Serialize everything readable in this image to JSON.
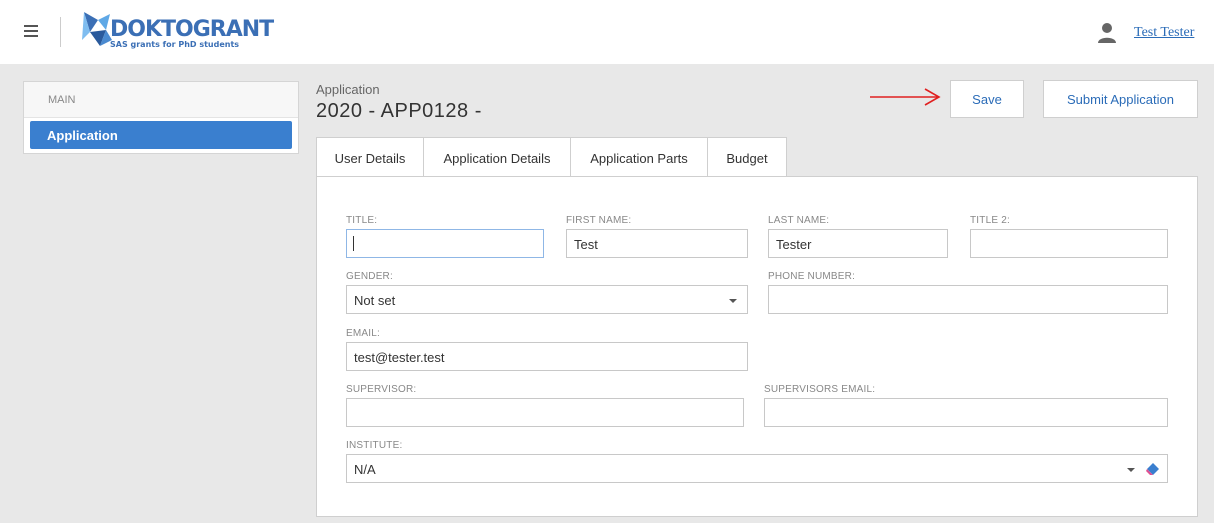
{
  "header": {
    "logo_text_main": "DOKTO",
    "logo_text_accent": "GRANT",
    "logo_subtitle": "SAS grants for PhD students",
    "user_name": "Test Tester",
    "menu_icon": "hamburger-icon",
    "user_icon": "user-icon"
  },
  "sidebar": {
    "section": "MAIN",
    "items": [
      {
        "label": "Application",
        "active": true
      }
    ]
  },
  "page": {
    "label": "Application",
    "title": "2020 - APP0128 -"
  },
  "toolbar": {
    "save_label": "Save",
    "submit_label": "Submit Application",
    "annotation_color": "#e02020"
  },
  "tabs": [
    {
      "label": "User Details",
      "active": true
    },
    {
      "label": "Application Details",
      "active": false
    },
    {
      "label": "Application Parts",
      "active": false
    },
    {
      "label": "Budget",
      "active": false
    }
  ],
  "form": {
    "title": {
      "label": "TITLE:",
      "value": ""
    },
    "first_name": {
      "label": "FIRST NAME:",
      "value": "Test"
    },
    "last_name": {
      "label": "LAST NAME:",
      "value": "Tester"
    },
    "title2": {
      "label": "TITLE 2:",
      "value": ""
    },
    "gender": {
      "label": "GENDER:",
      "value": "Not set"
    },
    "phone": {
      "label": "PHONE NUMBER:",
      "value": ""
    },
    "email": {
      "label": "EMAIL:",
      "value": "test@tester.test"
    },
    "supervisor": {
      "label": "SUPERVISOR:",
      "value": ""
    },
    "supervisor_email": {
      "label": "SUPERVISORS EMAIL:",
      "value": ""
    },
    "institute": {
      "label": "INSTITUTE:",
      "value": "N/A"
    }
  },
  "colors": {
    "accent": "#3a7fcf",
    "link": "#2b6cb8"
  }
}
